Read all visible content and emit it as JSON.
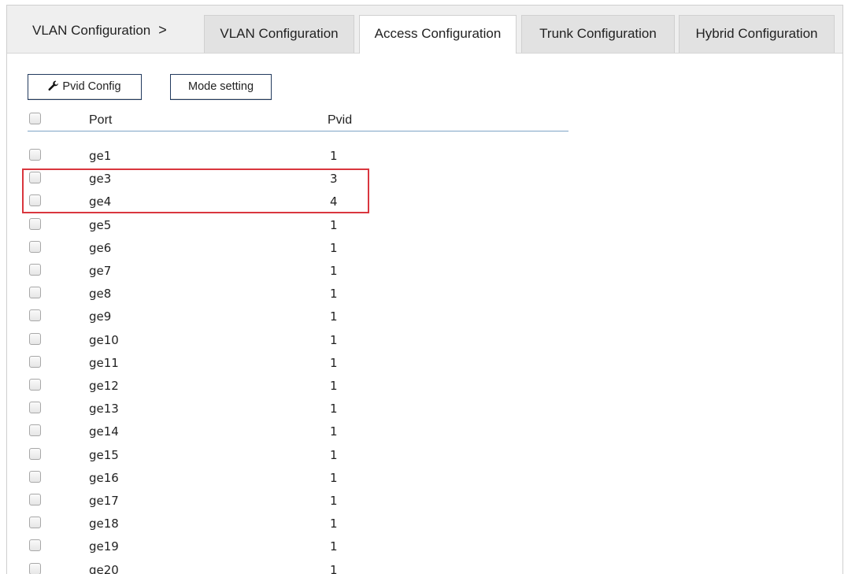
{
  "breadcrumb": {
    "label": "VLAN Configuration",
    "separator": ">"
  },
  "tabs": [
    {
      "label": "VLAN Configuration",
      "active": false
    },
    {
      "label": "Access Configuration",
      "active": true
    },
    {
      "label": "Trunk Configuration",
      "active": false
    },
    {
      "label": "Hybrid Configuration",
      "active": false
    }
  ],
  "toolbar": {
    "pvid_config_label": "Pvid Config",
    "pvid_config_icon": "wrench-icon",
    "mode_setting_label": "Mode setting"
  },
  "table": {
    "columns": [
      "Port",
      "Pvid"
    ],
    "rows": [
      {
        "port": "ge1",
        "pvid": "1"
      },
      {
        "port": "ge3",
        "pvid": "3"
      },
      {
        "port": "ge4",
        "pvid": "4"
      },
      {
        "port": "ge5",
        "pvid": "1"
      },
      {
        "port": "ge6",
        "pvid": "1"
      },
      {
        "port": "ge7",
        "pvid": "1"
      },
      {
        "port": "ge8",
        "pvid": "1"
      },
      {
        "port": "ge9",
        "pvid": "1"
      },
      {
        "port": "ge10",
        "pvid": "1"
      },
      {
        "port": "ge11",
        "pvid": "1"
      },
      {
        "port": "ge12",
        "pvid": "1"
      },
      {
        "port": "ge13",
        "pvid": "1"
      },
      {
        "port": "ge14",
        "pvid": "1"
      },
      {
        "port": "ge15",
        "pvid": "1"
      },
      {
        "port": "ge16",
        "pvid": "1"
      },
      {
        "port": "ge17",
        "pvid": "1"
      },
      {
        "port": "ge18",
        "pvid": "1"
      },
      {
        "port": "ge19",
        "pvid": "1"
      },
      {
        "port": "ge20",
        "pvid": "1"
      }
    ]
  },
  "colors": {
    "highlight_border": "#d9363e",
    "header_rule": "#7ea4c6",
    "button_border": "#223a5e"
  }
}
